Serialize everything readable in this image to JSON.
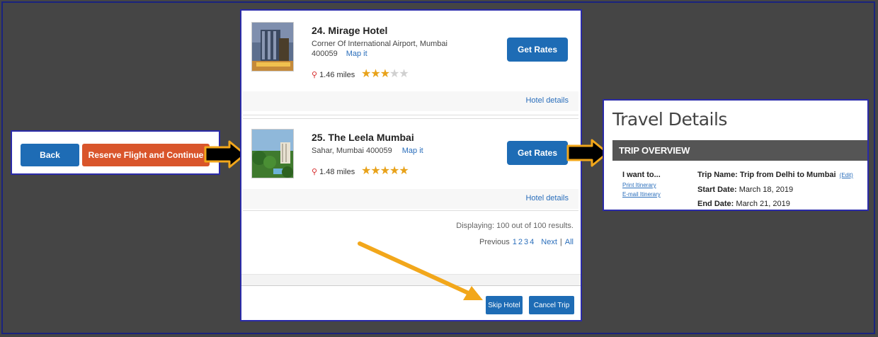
{
  "left": {
    "back_label": "Back",
    "reserve_label": "Reserve Flight and Continue"
  },
  "hotels": [
    {
      "name": "24. Mirage Hotel",
      "address_line1": "Corner Of International Airport, Mumbai",
      "address_line2": "400059",
      "map_link": "Map it",
      "distance": "1.46 miles",
      "rating": 3,
      "stars_total": 5,
      "get_rates_label": "Get Rates",
      "details_link": "Hotel details"
    },
    {
      "name": "25. The Leela Mumbai",
      "address_line1": "Sahar, Mumbai 400059",
      "map_link": "Map it",
      "distance": "1.48 miles",
      "rating": 5,
      "stars_total": 5,
      "get_rates_label": "Get Rates",
      "details_link": "Hotel details"
    }
  ],
  "results": {
    "displaying": "Displaying: 100 out of 100 results.",
    "previous": "Previous",
    "pages": [
      "1",
      "2",
      "3",
      "4"
    ],
    "next": "Next",
    "separator": "|",
    "all": "All"
  },
  "footer": {
    "skip_label": "Skip Hotel",
    "cancel_label": "Cancel Trip"
  },
  "travel": {
    "title": "Travel Details",
    "overview": "TRIP OVERVIEW",
    "i_want": "I want to...",
    "print_link": "Print Itinerary",
    "email_link": "E-mail Itinerary",
    "trip_name_label": "Trip Name:",
    "trip_name": "Trip from Delhi to Mumbai",
    "edit_link": "(Edit)",
    "start_label": "Start Date:",
    "start_value": "March 18, 2019",
    "end_label": "End Date:",
    "end_value": "March 21, 2019"
  },
  "colors": {
    "background": "#454545",
    "primary_button": "#1e6cb5",
    "reserve_button": "#d9552b",
    "panel_border": "#2a2aa8",
    "annotation_arrow": "#f2a71b",
    "star": "#e8a21a",
    "link": "#2a6ebb"
  }
}
